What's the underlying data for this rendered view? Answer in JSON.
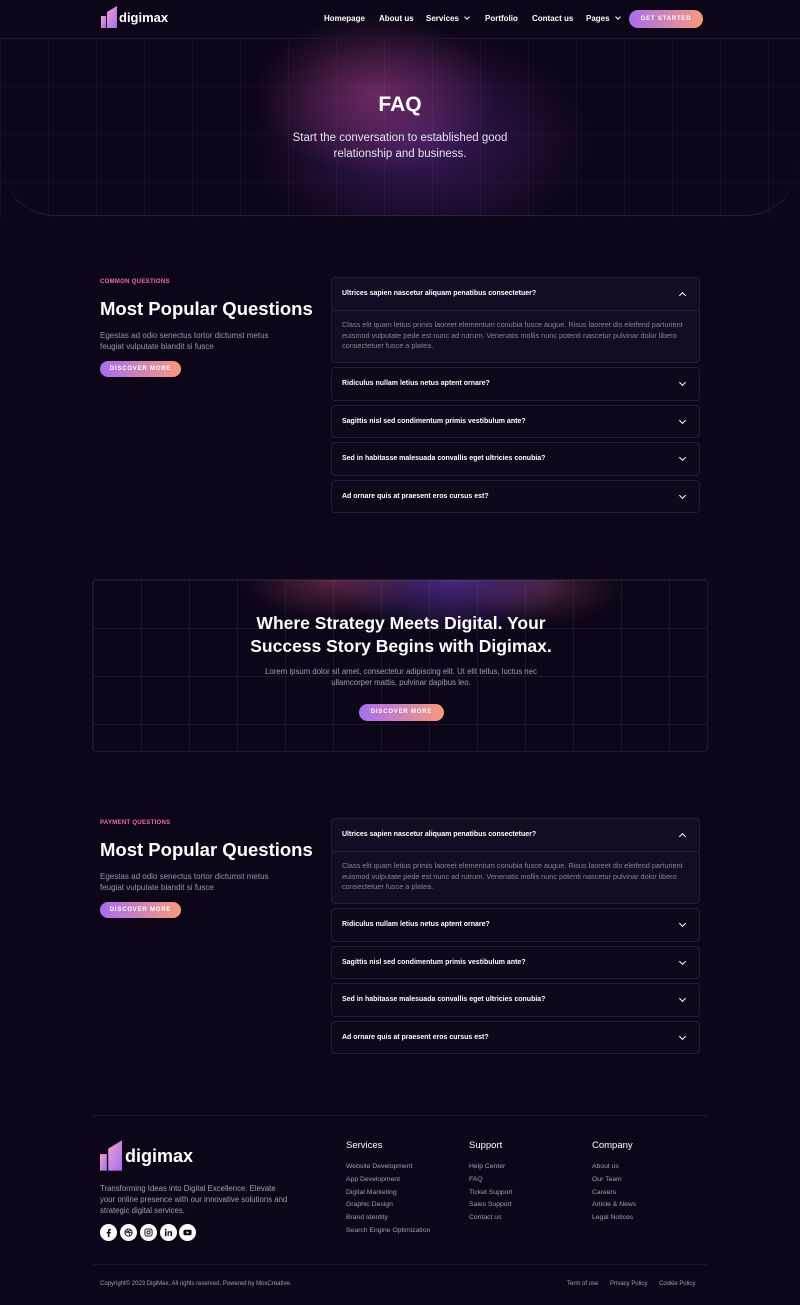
{
  "brand": {
    "name": "digimax"
  },
  "colors": {
    "background": "#0d0618",
    "accent_start": "#a66ef0",
    "accent_end": "#f79a7a",
    "eyebrow": "#f06bb0"
  },
  "nav": {
    "items": [
      {
        "label": "Homepage"
      },
      {
        "label": "About us"
      },
      {
        "label": "Services"
      },
      {
        "label": "Portfolio"
      },
      {
        "label": "Contact us"
      },
      {
        "label": "Pages"
      }
    ],
    "cta_label": "GET STARTED"
  },
  "hero": {
    "title": "FAQ",
    "subtitle": "Start the conversation to established good relationship and business."
  },
  "faq_sections": [
    {
      "eyebrow": "COMMON QUESTIONS",
      "title": "Most Popular Questions",
      "description": "Egestas ad odio senectus tortor dictumst metus feugiat vulputate blandit si fusce",
      "button": "DISCOVER MORE",
      "items": [
        {
          "question": "Ultrices sapien nascetur aliquam penatibus consectetuer?",
          "answer": "Class elit quam letius primis laoreet elementum conubia fusce augue. Risus laoreet dis eleifend parturient euismod vulputate pede est nunc ad rutrum. Venenatis mollis nunc potenti nascetur pulvinar dolor libero consectetuer fusce a platea.",
          "expanded": true
        },
        {
          "question": "Ridiculus nullam letius netus aptent ornare?",
          "expanded": false
        },
        {
          "question": "Sagittis nisl sed condimentum primis vestibulum ante?",
          "expanded": false
        },
        {
          "question": "Sed in habitasse malesuada convallis eget ultricies conubia?",
          "expanded": false
        },
        {
          "question": "Ad ornare quis at praesent eros cursus est?",
          "expanded": false
        }
      ]
    },
    {
      "eyebrow": "PAYMENT QUESTIONS",
      "title": "Most Popular Questions",
      "description": "Egestas ad odio senectus tortor dictumst metus feugiat vulputate blandit si fusce",
      "button": "DISCOVER MORE",
      "items": [
        {
          "question": "Ultrices sapien nascetur aliquam penatibus consectetuer?",
          "answer": "Class elit quam letius primis laoreet elementum conubia fusce augue. Risus laoreet dis eleifend parturient euismod vulputate pede est nunc ad rutrum. Venenatis mollis nunc potenti nascetur pulvinar dolor libero consectetuer fusce a platea.",
          "expanded": true
        },
        {
          "question": "Ridiculus nullam letius netus aptent ornare?",
          "expanded": false
        },
        {
          "question": "Sagittis nisl sed condimentum primis vestibulum ante?",
          "expanded": false
        },
        {
          "question": "Sed in habitasse malesuada convallis eget ultricies conubia?",
          "expanded": false
        },
        {
          "question": "Ad ornare quis at praesent eros cursus est?",
          "expanded": false
        }
      ]
    }
  ],
  "cta": {
    "title_line1": "Where Strategy Meets Digital. Your",
    "title_line2": "Success Story Begins with Digimax.",
    "description": "Lorem ipsum dolor sit amet, consectetur adipiscing elit. Ut elit tellus, luctus nec ullamcorper mattis, pulvinar dapibus leo.",
    "button": "DISCOVER MORE"
  },
  "footer": {
    "description": "Transforming Ideas into Digital Excellence. Elevate your online presence with our innovative solutions and strategic digital services.",
    "socials": [
      "facebook-icon",
      "dribbble-icon",
      "instagram-icon",
      "linkedin-icon",
      "youtube-icon"
    ],
    "columns": [
      {
        "title": "Services",
        "links": [
          "Website Development",
          "App Development",
          "Digital Marketing",
          "Graphic Design",
          "Brand Identity",
          "Search Engine Optimization"
        ]
      },
      {
        "title": "Support",
        "links": [
          "Help Center",
          "FAQ",
          "Ticket Support",
          "Sales Support",
          "Contact us"
        ]
      },
      {
        "title": "Company",
        "links": [
          "About us",
          "Our Team",
          "Careers",
          "Article & News",
          "Legal Notices"
        ]
      }
    ],
    "copyright": "Copyright© 2023 DigiMax, All rights reserved. Powered by MoxCreative.",
    "legal_links": [
      "Term of use",
      "Privacy Policy",
      "Cookie Policy"
    ]
  }
}
